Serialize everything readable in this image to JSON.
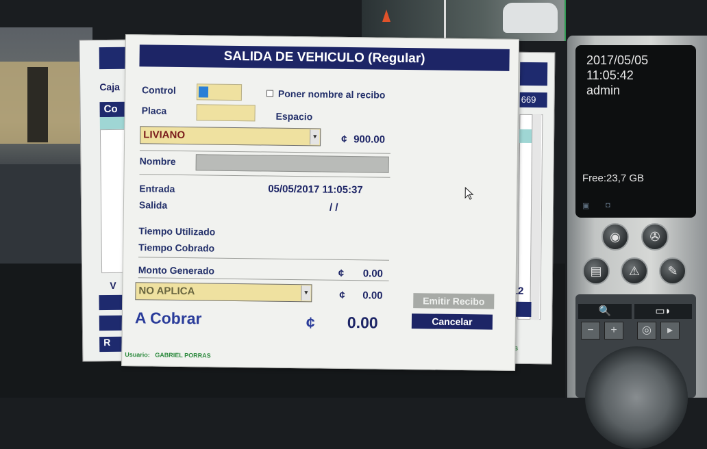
{
  "dialog": {
    "title": "SALIDA DE VEHICULO (Regular)",
    "control_label": "Control",
    "placa_label": "Placa",
    "checkbox_label": "Poner nombre al recibo",
    "espacio_label": "Espacio",
    "vehicle_type": "LIVIANO",
    "tarifa_currency": "¢",
    "tarifa": "900.00",
    "nombre_label": "Nombre",
    "entrada_label": "Entrada",
    "entrada_value": "05/05/2017  11:05:37",
    "salida_label": "Salida",
    "salida_value": "/ /",
    "tiempo_utilizado_label": "Tiempo Utilizado",
    "tiempo_cobrado_label": "Tiempo Cobrado",
    "monto_label": "Monto Generado",
    "monto_currency": "¢",
    "monto_value": "0.00",
    "descuento_option": "NO APLICA",
    "descuento_currency": "¢",
    "descuento_value": "0.00",
    "cobrar_label": "A Cobrar",
    "cobrar_currency": "¢",
    "cobrar_value": "0.00",
    "emitir_button": "Emitir Recibo",
    "cancelar_button": "Cancelar",
    "usuario_label": "Usuario:",
    "usuario_name": "GABRIEL PORRAS"
  },
  "back_window_left": {
    "caja_label": "Caja",
    "header_fragment": "Co",
    "v_fragment": "V",
    "btn_fragment": "R"
  },
  "back_window_right": {
    "number_fragment": "669",
    "n12": "12",
    "footer_fragment": "AS"
  },
  "dvr": {
    "date": "2017/05/05",
    "time": "11:05:42",
    "user": "admin",
    "free_space": "Free:23,7 GB"
  },
  "colors": {
    "title_bar": "#1d2566",
    "input_yellow": "#efe1a0",
    "label_blue": "#23306a",
    "user_green": "#2d8a3e"
  }
}
